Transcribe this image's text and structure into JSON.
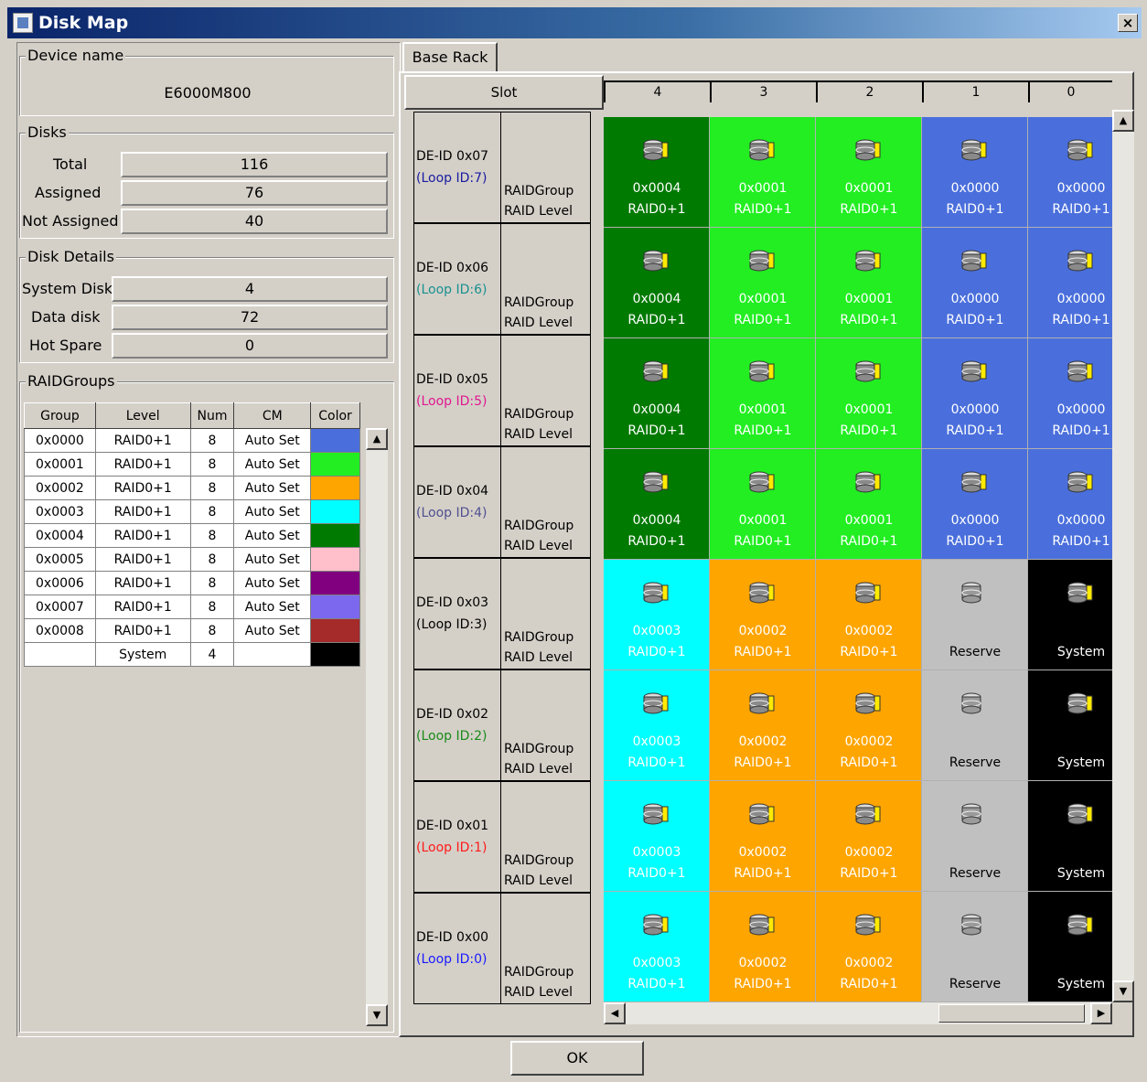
{
  "window": {
    "title": "Disk Map",
    "close": "×"
  },
  "device": {
    "legend": "Device name",
    "name": "E6000M800"
  },
  "disks": {
    "legend": "Disks",
    "total_label": "Total",
    "total": "116",
    "assigned_label": "Assigned",
    "assigned": "76",
    "not_assigned_label": "Not Assigned",
    "not_assigned": "40"
  },
  "details": {
    "legend": "Disk Details",
    "system_label": "System Disk",
    "system": "4",
    "data_label": "Data disk",
    "data": "72",
    "hot_label": "Hot Spare",
    "hot": "0"
  },
  "raidgroups": {
    "legend": "RAIDGroups",
    "headers": [
      "Group",
      "Level",
      "Num",
      "CM",
      "Color"
    ],
    "rows": [
      {
        "group": "0x0000",
        "level": "RAID0+1",
        "num": "8",
        "cm": "Auto Set",
        "color": "#4a6fdc"
      },
      {
        "group": "0x0001",
        "level": "RAID0+1",
        "num": "8",
        "cm": "Auto Set",
        "color": "#22ee22"
      },
      {
        "group": "0x0002",
        "level": "RAID0+1",
        "num": "8",
        "cm": "Auto Set",
        "color": "#ffa500"
      },
      {
        "group": "0x0003",
        "level": "RAID0+1",
        "num": "8",
        "cm": "Auto Set",
        "color": "#00ffff"
      },
      {
        "group": "0x0004",
        "level": "RAID0+1",
        "num": "8",
        "cm": "Auto Set",
        "color": "#007a00"
      },
      {
        "group": "0x0005",
        "level": "RAID0+1",
        "num": "8",
        "cm": "Auto Set",
        "color": "#ffc0cb"
      },
      {
        "group": "0x0006",
        "level": "RAID0+1",
        "num": "8",
        "cm": "Auto Set",
        "color": "#800080"
      },
      {
        "group": "0x0007",
        "level": "RAID0+1",
        "num": "8",
        "cm": "Auto Set",
        "color": "#7b68ee"
      },
      {
        "group": "0x0008",
        "level": "RAID0+1",
        "num": "8",
        "cm": "Auto Set",
        "color": "#a52a2a"
      },
      {
        "group": "",
        "level": "System",
        "num": "4",
        "cm": "",
        "color": "#000000"
      }
    ]
  },
  "rack": {
    "tab": "Base Rack",
    "slot_label": "Slot",
    "columns": [
      "4",
      "3",
      "2",
      "1",
      "0"
    ],
    "rowlabel_a": "RAIDGroup",
    "rowlabel_b": "RAID Level",
    "rows": [
      {
        "de": "DE-ID 0x07",
        "loop": "(Loop ID:7)",
        "loop_color": "#1a1aa0"
      },
      {
        "de": "DE-ID 0x06",
        "loop": "(Loop ID:6)",
        "loop_color": "#1a9090"
      },
      {
        "de": "DE-ID 0x05",
        "loop": "(Loop ID:5)",
        "loop_color": "#e01890"
      },
      {
        "de": "DE-ID 0x04",
        "loop": "(Loop ID:4)",
        "loop_color": "#505090"
      },
      {
        "de": "DE-ID 0x03",
        "loop": "(Loop ID:3)",
        "loop_color": "#000000"
      },
      {
        "de": "DE-ID 0x02",
        "loop": "(Loop ID:2)",
        "loop_color": "#1a8a1a"
      },
      {
        "de": "DE-ID 0x01",
        "loop": "(Loop ID:1)",
        "loop_color": "#ff1a1a"
      },
      {
        "de": "DE-ID 0x00",
        "loop": "(Loop ID:0)",
        "loop_color": "#1a1aff"
      }
    ],
    "upper_cells": [
      {
        "g": "0x0004",
        "l": "RAID0+1",
        "bg": "#007a00"
      },
      {
        "g": "0x0001",
        "l": "RAID0+1",
        "bg": "#22ee22"
      },
      {
        "g": "0x0001",
        "l": "RAID0+1",
        "bg": "#22ee22"
      },
      {
        "g": "0x0000",
        "l": "RAID0+1",
        "bg": "#4a6fdc"
      },
      {
        "g": "0x0000",
        "l": "RAID0+1",
        "bg": "#4a6fdc"
      }
    ],
    "lower_cells": [
      {
        "g": "0x0003",
        "l": "RAID0+1",
        "bg": "#00ffff"
      },
      {
        "g": "0x0002",
        "l": "RAID0+1",
        "bg": "#ffa500"
      },
      {
        "g": "0x0002",
        "l": "RAID0+1",
        "bg": "#ffa500"
      },
      {
        "g": "",
        "l": "Reserve",
        "bg": "#c0c0c0"
      },
      {
        "g": "",
        "l": "System",
        "bg": "#000000"
      }
    ]
  },
  "ok": "OK"
}
